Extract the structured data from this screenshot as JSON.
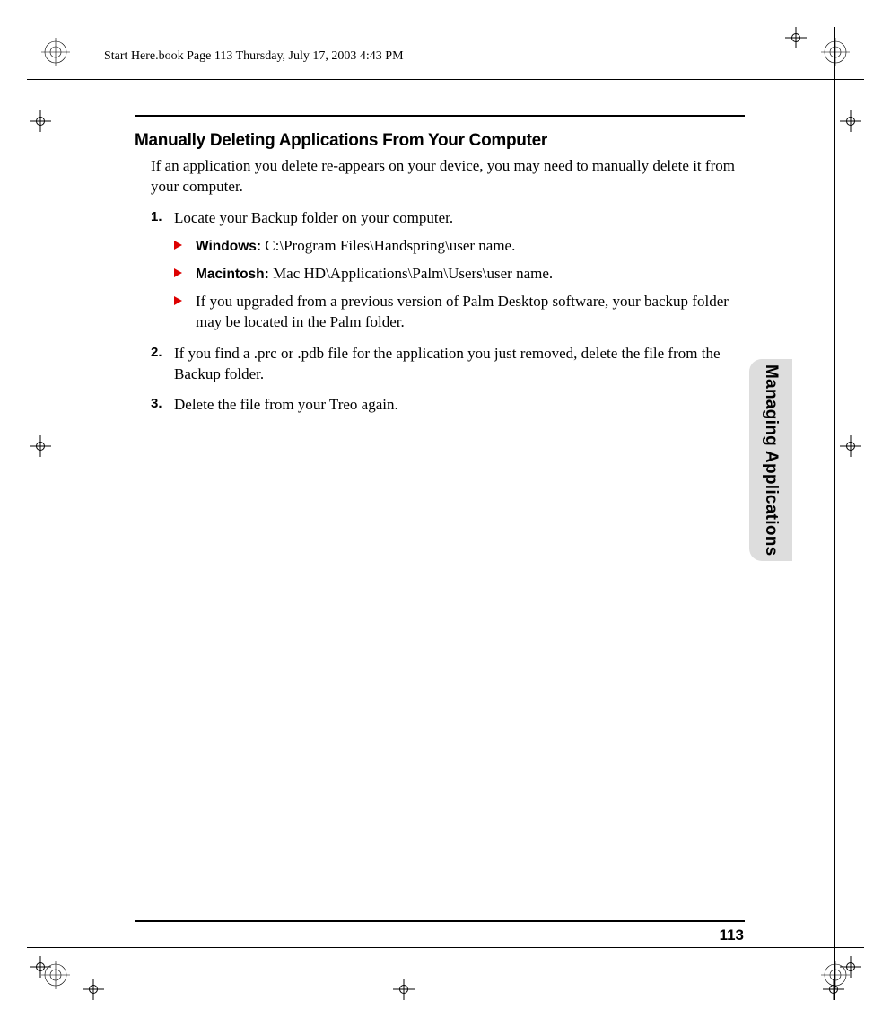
{
  "header": "Start Here.book  Page 113  Thursday, July 17, 2003  4:43 PM",
  "heading": "Manually Deleting Applications From Your Computer",
  "intro": "If an application you delete re-appears on your device, you may need to manually delete it from your computer.",
  "steps": {
    "s1": {
      "num": "1.",
      "text": "Locate your Backup folder on your computer.",
      "bullets": {
        "b1_label": "Windows:",
        "b1_text": " C:\\Program Files\\Handspring\\user name.",
        "b2_label": "Macintosh:",
        "b2_text": " Mac HD\\Applications\\Palm\\Users\\user name.",
        "b3_text": "If you upgraded from a previous version of Palm Desktop software, your backup folder may be located in the Palm folder."
      }
    },
    "s2": {
      "num": "2.",
      "text": "If you find a .prc or .pdb file for the application you just removed, delete the file from the Backup folder."
    },
    "s3": {
      "num": "3.",
      "text": "Delete the file from your Treo again."
    }
  },
  "side_tab": "Managing Applications",
  "page_number": "113"
}
